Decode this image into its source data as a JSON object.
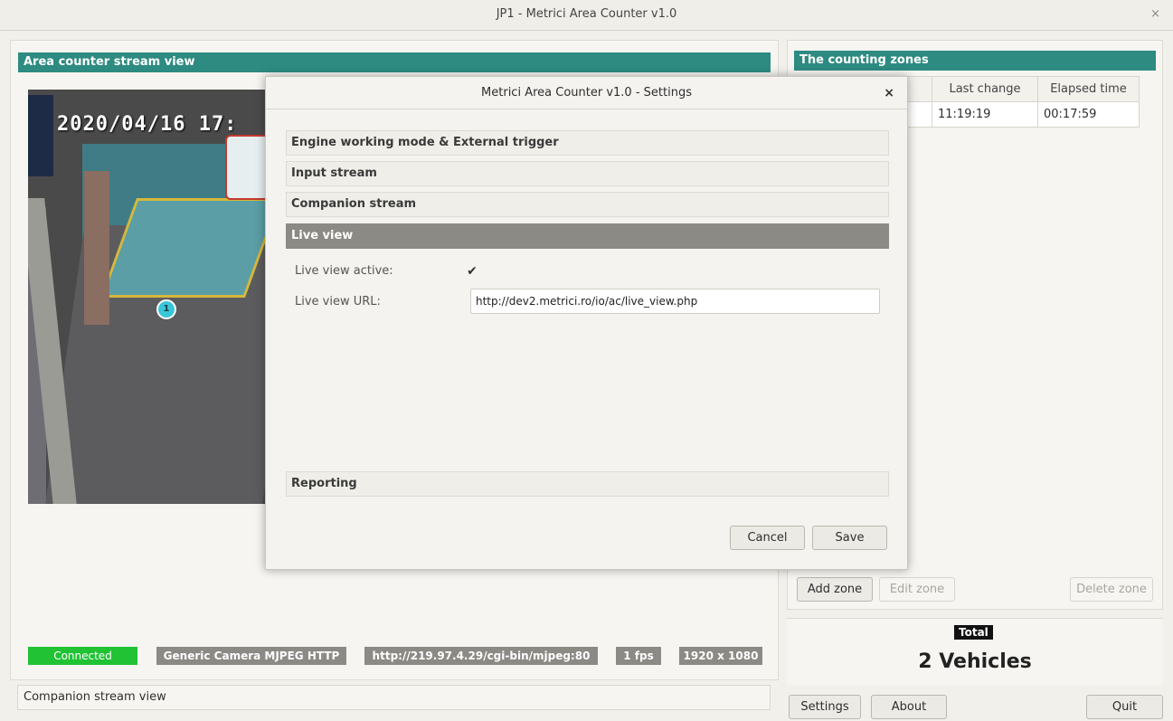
{
  "window": {
    "title": "JP1 - Metrici Area Counter v1.0",
    "close_glyph": "×"
  },
  "stream_view": {
    "header": "Area counter stream view",
    "timestamp": "2020/04/16 17:",
    "zone_marker": "1"
  },
  "status_bar": {
    "connected": "Connected",
    "camera_type": "Generic Camera MJPEG HTTP",
    "stream_url": "http://219.97.4.29/cgi-bin/mjpeg:80",
    "fps": "1 fps",
    "resolution": "1920 x 1080",
    "colors": {
      "connected": "#21c234",
      "info": "#8c8a84"
    }
  },
  "companion": {
    "label": "Companion stream view"
  },
  "zones_panel": {
    "header": "The counting zones",
    "columns": [
      "Last change",
      "Elapsed time"
    ],
    "rows": [
      {
        "last_change": "11:19:19",
        "elapsed_time": "00:17:59"
      }
    ],
    "add_zone": "Add zone",
    "edit_zone": "Edit zone",
    "delete_zone": "Delete zone"
  },
  "total": {
    "label": "Total",
    "value": "2 Vehicles"
  },
  "bottom_buttons": {
    "settings": "Settings",
    "about": "About",
    "quit": "Quit"
  },
  "dialog": {
    "title": "Metrici Area Counter v1.0 - Settings",
    "close_glyph": "×",
    "sections": [
      "Engine working mode & External trigger",
      "Input stream",
      "Companion stream",
      "Live view",
      "Reporting"
    ],
    "live_view": {
      "active_label": "Live view active:",
      "active_checked": true,
      "check_glyph": "✔",
      "url_label": "Live view URL:",
      "url_value": "http://dev2.metrici.ro/io/ac/live_view.php"
    },
    "cancel": "Cancel",
    "save": "Save"
  },
  "accent_color": "#2d8b81"
}
